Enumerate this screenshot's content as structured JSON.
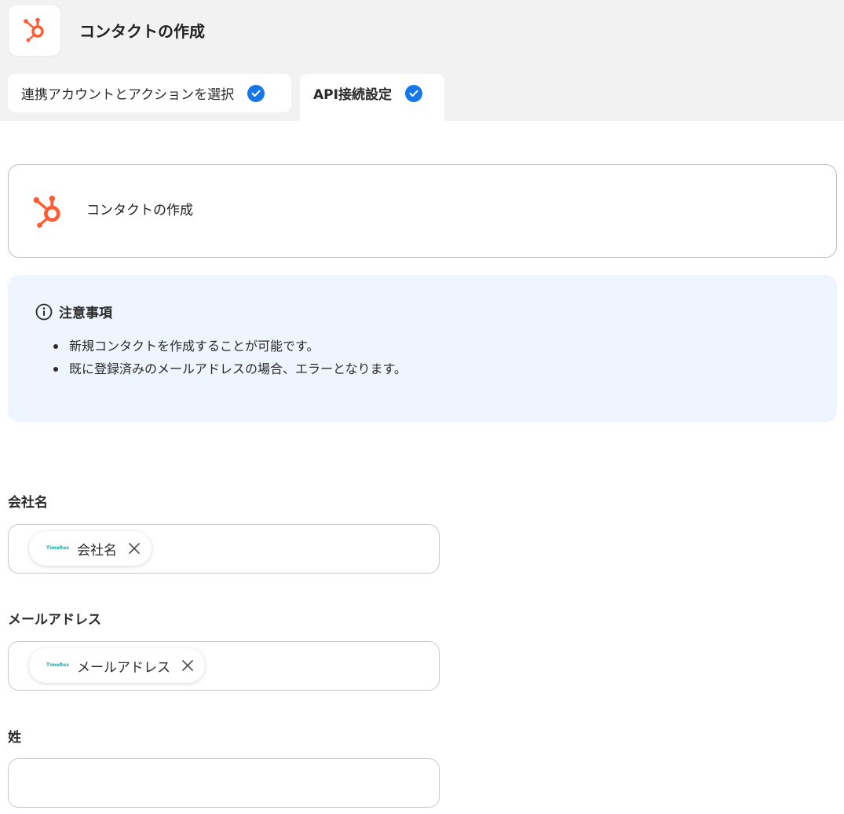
{
  "header": {
    "title": "コンタクトの作成",
    "app_icon": "hubspot-icon",
    "accent": "#ff5c35"
  },
  "tabs": [
    {
      "label": "連携アカウントとアクションを選択",
      "completed": true
    },
    {
      "label": "API接続設定",
      "completed": true
    }
  ],
  "action_card": {
    "title": "コンタクトの作成",
    "icon": "hubspot-icon"
  },
  "notice": {
    "title": "注意事項",
    "icon": "info-icon",
    "items": [
      "新規コンタクトを作成することが可能です。",
      "既に登録済みのメールアドレスの場合、エラーとなります。"
    ]
  },
  "fields": [
    {
      "label": "会社名",
      "chip": {
        "source": "TimeRex",
        "label": "会社名"
      }
    },
    {
      "label": "メールアドレス",
      "chip": {
        "source": "TimeRex",
        "label": "メールアドレス"
      }
    },
    {
      "label": "姓",
      "value": ""
    }
  ],
  "colors": {
    "check": "#1677e8",
    "notice_bg": "#eef5fe",
    "chip_logo": "#2aa6a0"
  }
}
